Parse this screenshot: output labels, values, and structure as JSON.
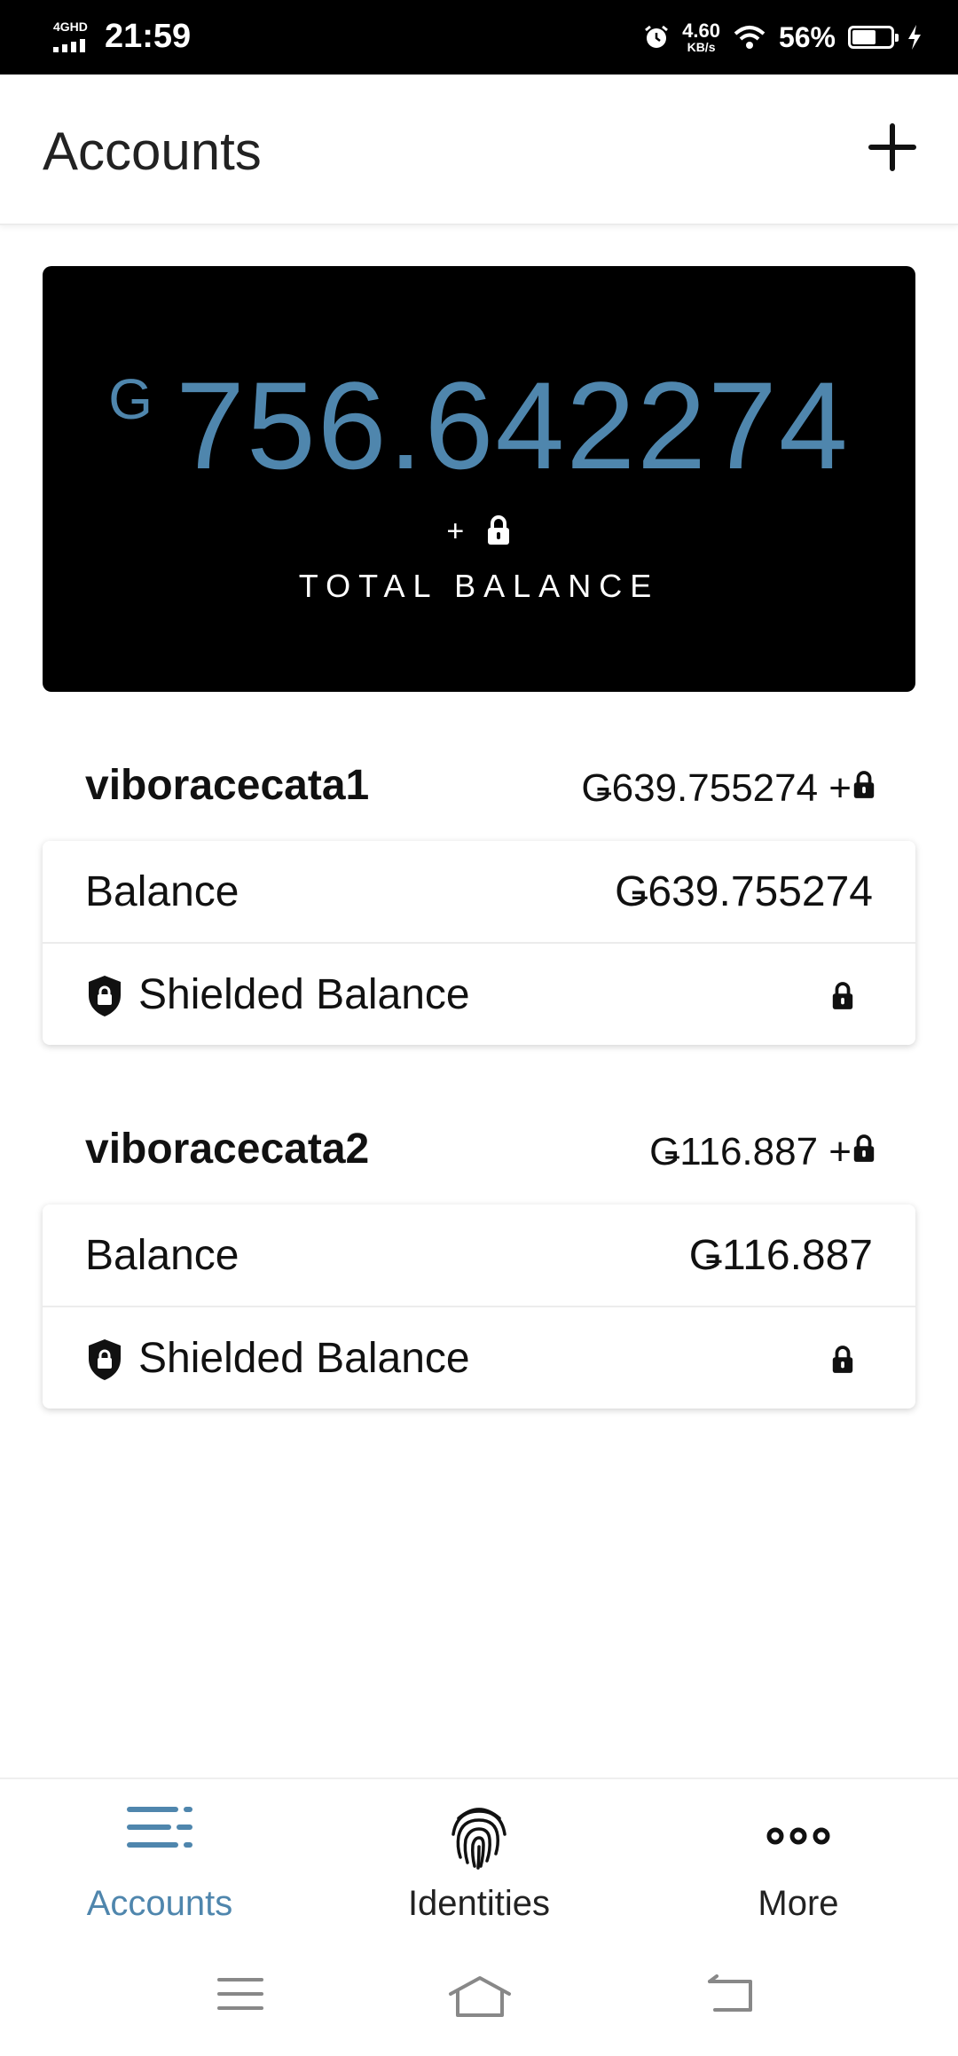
{
  "status_bar": {
    "network": "4GHD",
    "time": "21:59",
    "speed_value": "4.60",
    "speed_unit": "KB/s",
    "battery_percent": "56%",
    "battery_level": 0.56
  },
  "header": {
    "title": "Accounts",
    "add_icon": "plus-icon"
  },
  "total_card": {
    "currency": "G",
    "amount": "756.642274",
    "locked_suffix": "+",
    "label": "TOTAL BALANCE",
    "amount_color": "#4f86ad"
  },
  "accounts": [
    {
      "name": "viboracecata1",
      "summary": "Ǥ639.755274 +",
      "balance_label": "Balance",
      "balance_value": "Ǥ639.755274",
      "shielded_label": "Shielded Balance"
    },
    {
      "name": "viboracecata2",
      "summary": "Ǥ116.887 +",
      "balance_label": "Balance",
      "balance_value": "Ǥ116.887",
      "shielded_label": "Shielded Balance"
    }
  ],
  "bottom_nav": {
    "items": [
      {
        "label": "Accounts",
        "icon": "list-icon",
        "active": true
      },
      {
        "label": "Identities",
        "icon": "fingerprint-icon",
        "active": false
      },
      {
        "label": "More",
        "icon": "more-dots-icon",
        "active": false
      }
    ]
  },
  "system_nav": {
    "icons": [
      "menu-icon",
      "home-icon",
      "back-icon"
    ]
  },
  "colors": {
    "accent": "#4f86ad",
    "card_bg": "#000000"
  }
}
